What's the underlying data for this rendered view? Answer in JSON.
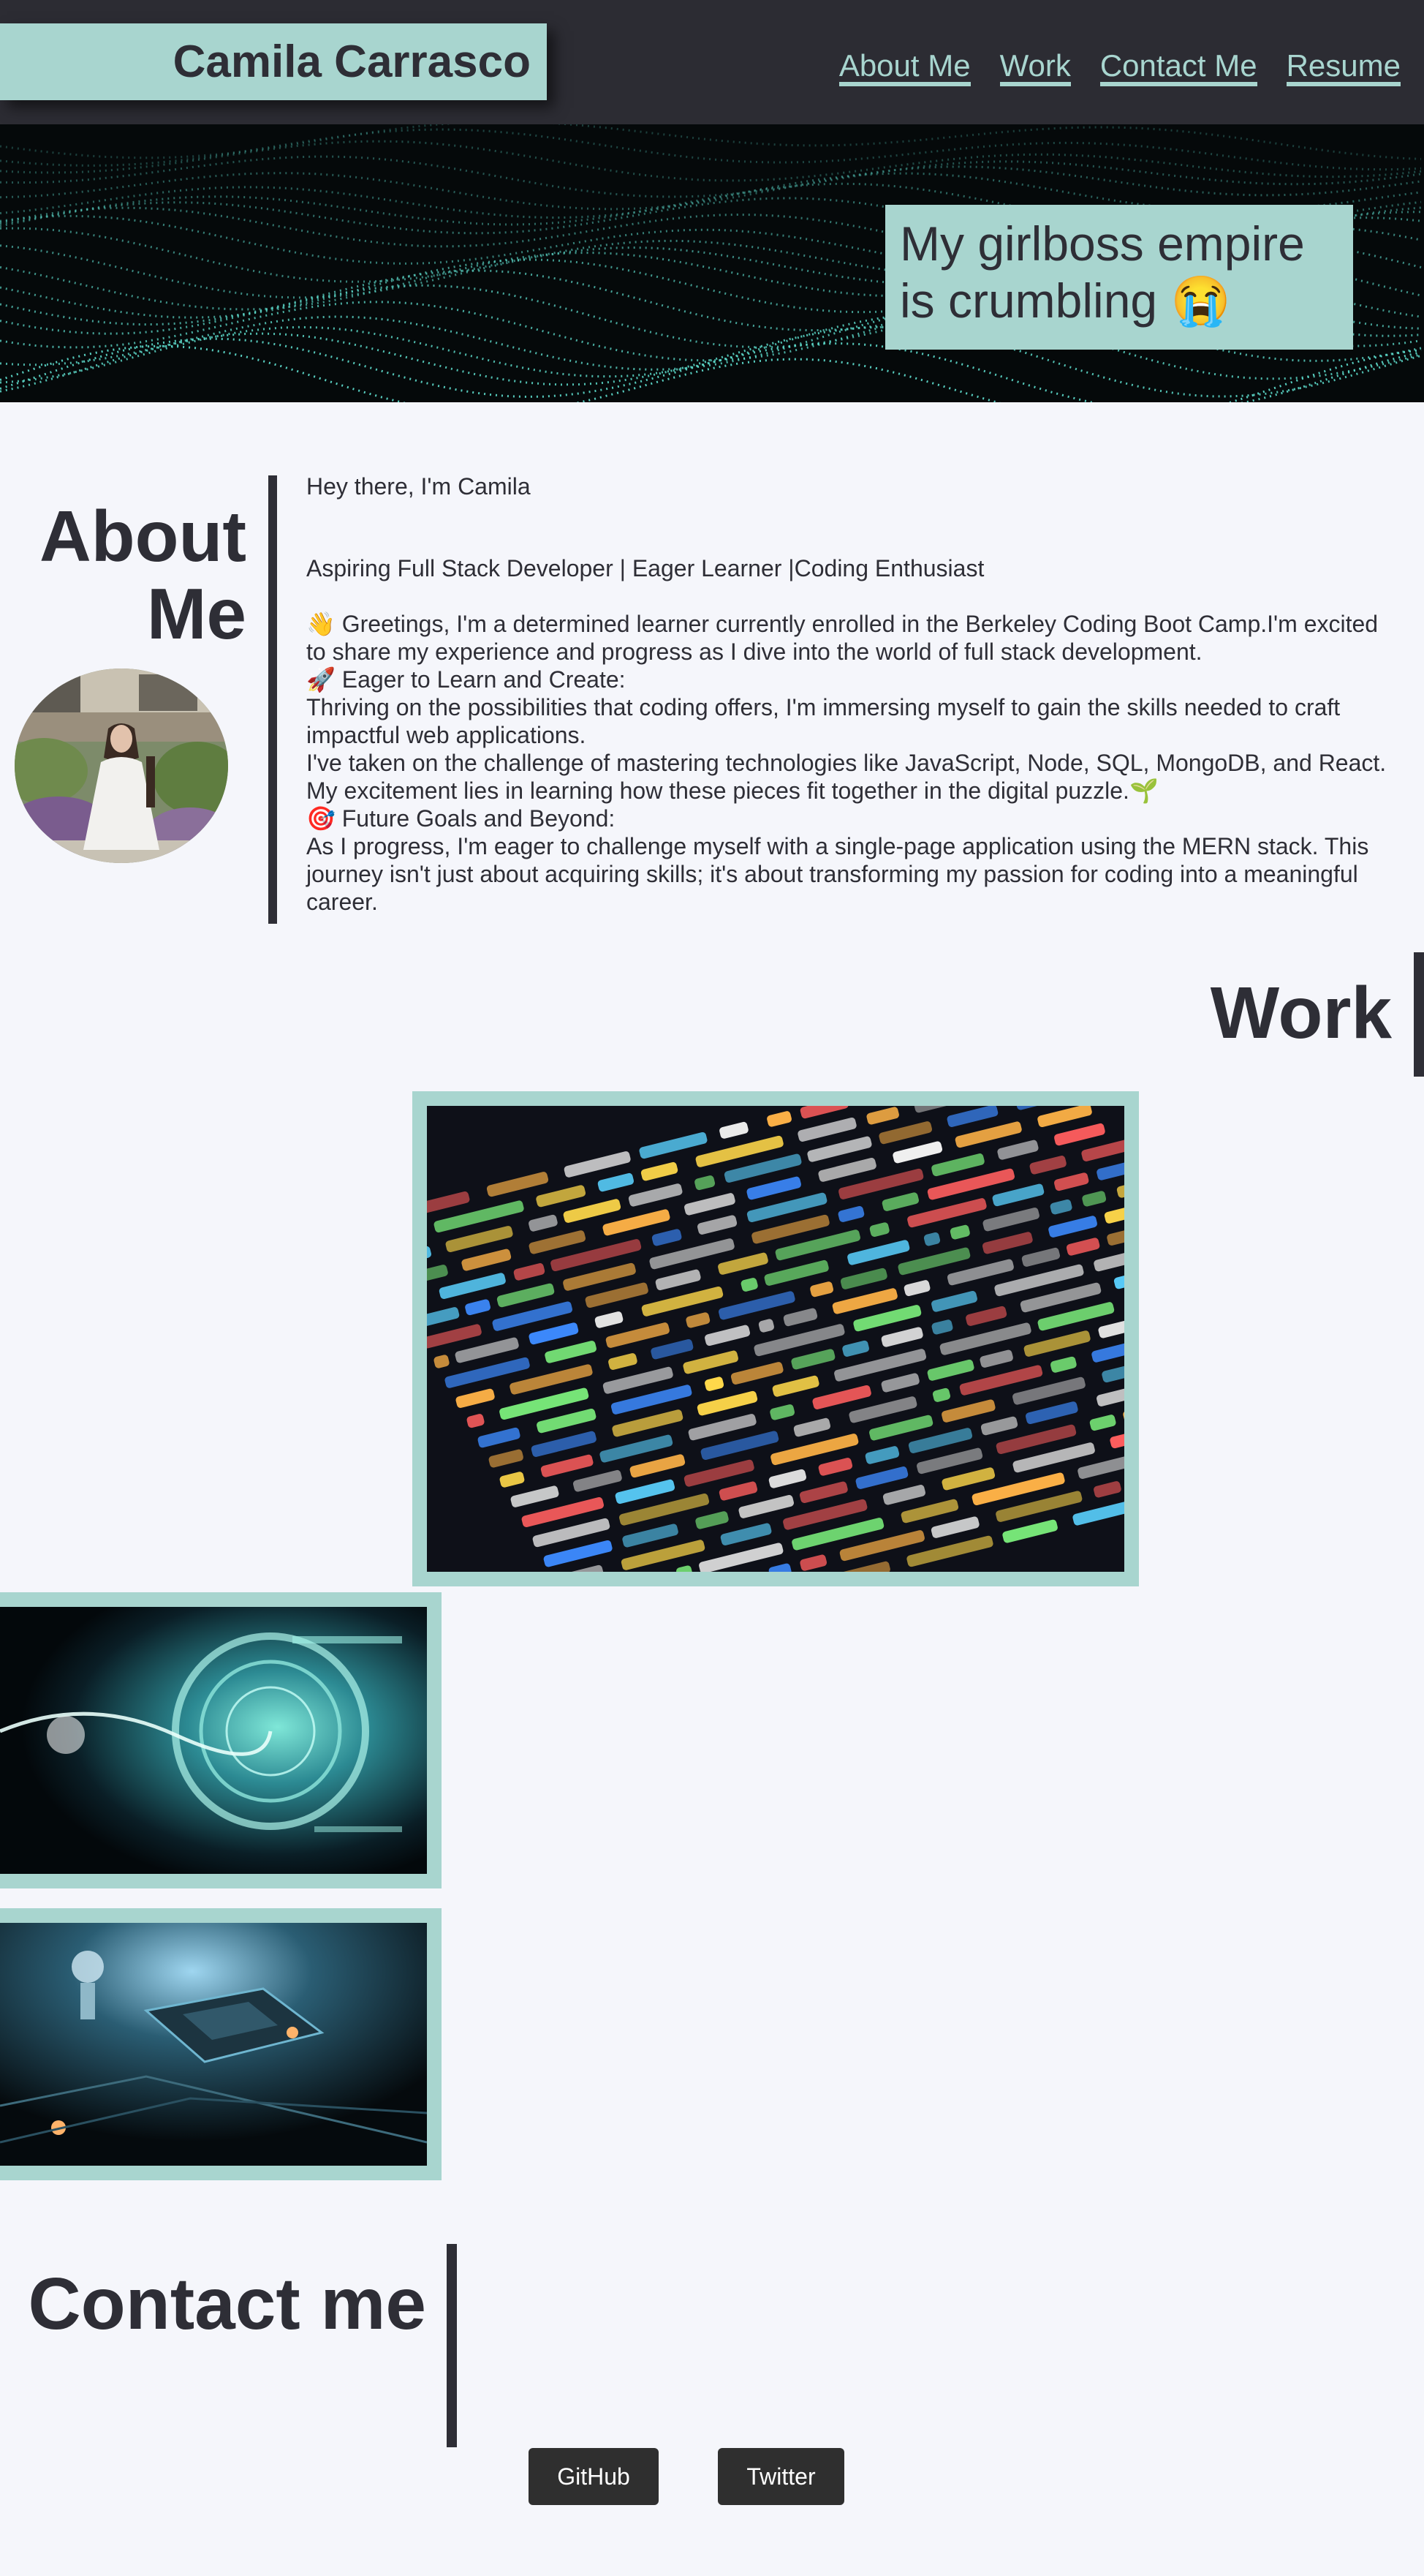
{
  "header": {
    "brand": "Camila Carrasco",
    "nav": [
      "About Me",
      "Work",
      "Contact Me",
      "Resume"
    ]
  },
  "hero": {
    "tagline": "My girlboss empire is crumbling 😭"
  },
  "about": {
    "title": "About Me",
    "greeting": "Hey there, I'm Camila",
    "subtitle": "Aspiring Full Stack Developer | Eager Learner |Coding Enthusiast",
    "lines": [
      "👋 Greetings, I'm a determined learner currently enrolled in the Berkeley Coding Boot Camp.I'm excited to share my experience and progress as I dive into the world of full stack development.",
      "🚀 Eager to Learn and Create:",
      "Thriving on the possibilities that coding offers, I'm immersing myself to gain the skills needed to craft impactful web applications.",
      "I've taken on the challenge of mastering technologies like JavaScript, Node, SQL, MongoDB, and React. My excitement lies in learning how these pieces fit together in the digital puzzle.🌱",
      "🎯 Future Goals and Beyond:",
      "As I progress, I'm eager to challenge myself with a single-page application using the MERN stack. This journey isn't just about acquiring skills; it's about transforming my passion for coding into a meaningful career."
    ]
  },
  "work": {
    "title": "Work"
  },
  "contact": {
    "title": "Contact me",
    "buttons": [
      "GitHub",
      "Twitter"
    ]
  },
  "colors": {
    "accent": "#a8d5cf",
    "dark": "#2e2e36",
    "header_bg": "#2c2c33",
    "page_bg": "#f5f6fb",
    "button_bg": "#2f2f2f"
  }
}
